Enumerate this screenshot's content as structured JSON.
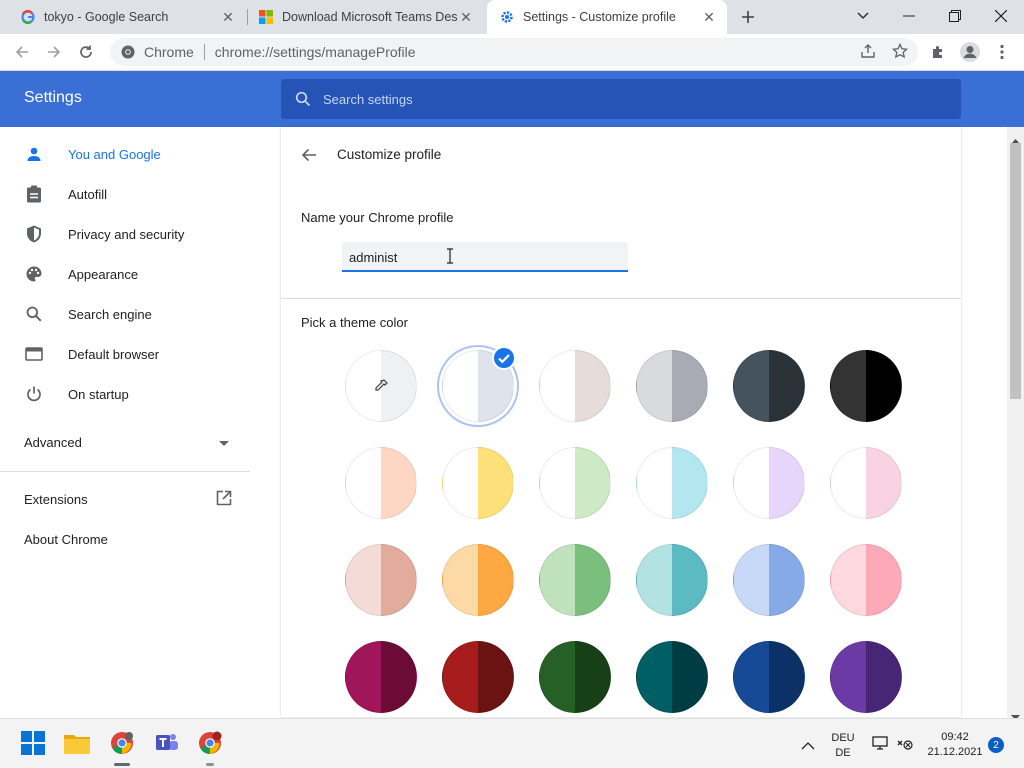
{
  "browser": {
    "tabs": [
      {
        "title": "tokyo - Google Search",
        "icon": "google-icon"
      },
      {
        "title": "Download Microsoft Teams Desk",
        "icon": "microsoft-icon"
      },
      {
        "title": "Settings - Customize profile",
        "icon": "settings-gear-icon"
      }
    ],
    "active_tab": 2,
    "omnibox": {
      "site": "Chrome",
      "url": "chrome://settings/manageProfile"
    }
  },
  "settings": {
    "title": "Settings",
    "search_placeholder": "Search settings",
    "nav": [
      {
        "label": "You and Google",
        "icon": "person-icon",
        "selected": true
      },
      {
        "label": "Autofill",
        "icon": "clipboard-icon"
      },
      {
        "label": "Privacy and security",
        "icon": "shield-icon"
      },
      {
        "label": "Appearance",
        "icon": "palette-icon"
      },
      {
        "label": "Search engine",
        "icon": "search-icon"
      },
      {
        "label": "Default browser",
        "icon": "browser-window-icon"
      },
      {
        "label": "On startup",
        "icon": "power-icon"
      }
    ],
    "advanced": "Advanced",
    "extensions": "Extensions",
    "about": "About Chrome"
  },
  "page": {
    "heading": "Customize profile",
    "name_label": "Name your Chrome profile",
    "name_value": "administ",
    "theme_label": "Pick a theme color",
    "selected_theme": 1,
    "themes": [
      [
        "#ffffff",
        "#eef0f4"
      ],
      [
        "#ffffff",
        "#dfe3ec"
      ],
      [
        "#ffffff",
        "#e6dcda"
      ],
      [
        "#d9dade",
        "#a8abb3"
      ],
      [
        "#45535f",
        "#2b3237"
      ],
      [
        "#333333",
        "#000000"
      ],
      [
        "#ffffff",
        "#fdd6c4"
      ],
      [
        "#ffffff",
        "#fee07a"
      ],
      [
        "#ffffff",
        "#cde9c6"
      ],
      [
        "#ffffff",
        "#b4e6f0"
      ],
      [
        "#ffffff",
        "#e7d6fb"
      ],
      [
        "#ffffff",
        "#f9d3e1"
      ],
      [
        "#f4dbd6",
        "#e3ab9b"
      ],
      [
        "#fdd9a6",
        "#fda842"
      ],
      [
        "#bfe2bd",
        "#7abf7b"
      ],
      [
        "#b3e2e2",
        "#5cbac2"
      ],
      [
        "#c8d9f7",
        "#86aae7"
      ],
      [
        "#fdd8df",
        "#fcaab8"
      ],
      [
        "#a1155a",
        "#6c0c36"
      ],
      [
        "#a61b1b",
        "#6b1212"
      ],
      [
        "#276027",
        "#184018"
      ],
      [
        "#005f65",
        "#003d42"
      ],
      [
        "#164a96",
        "#0c3166"
      ],
      [
        "#6b3aa5",
        "#472675"
      ]
    ]
  },
  "taskbar": {
    "lang": "DEU",
    "lang_sub": "DE",
    "time": "09:42",
    "date": "21.12.2021",
    "notifications": "2"
  }
}
